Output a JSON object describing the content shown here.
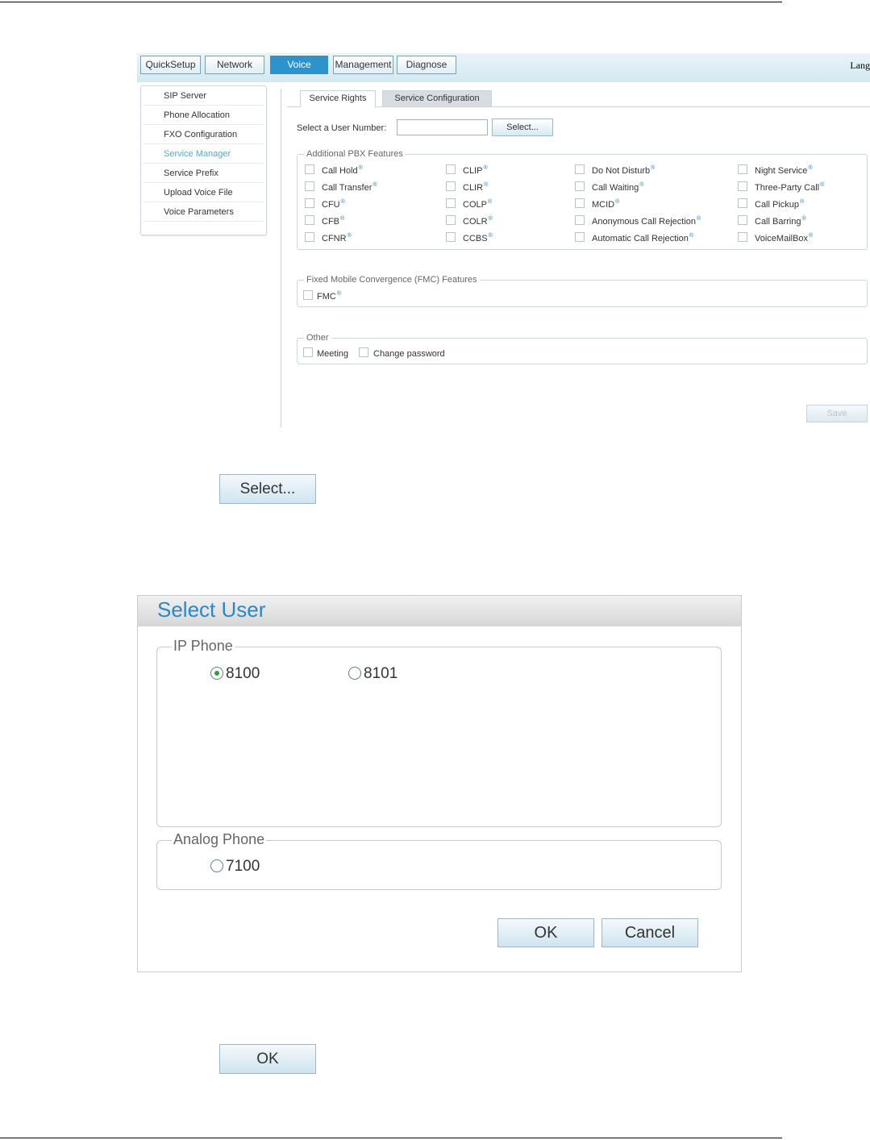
{
  "screenshot": {
    "nav_tabs": [
      "QuickSetup",
      "Network",
      "Voice",
      "Management",
      "Diagnose"
    ],
    "active_nav": "Voice",
    "language_label": "Lang",
    "sidebar": [
      {
        "label": "SIP Server",
        "active": false
      },
      {
        "label": "Phone Allocation",
        "active": false
      },
      {
        "label": "FXO Configuration",
        "active": false
      },
      {
        "label": "Service Manager",
        "active": true
      },
      {
        "label": "Service Prefix",
        "active": false
      },
      {
        "label": "Upload Voice File",
        "active": false
      },
      {
        "label": "Voice Parameters",
        "active": false
      }
    ],
    "sub_tabs": [
      "Service Rights",
      "Service Configuration"
    ],
    "user_number_label": "Select a User Number:",
    "user_number_value": "",
    "select_button": "Select...",
    "pbx": {
      "legend": "Additional PBX Features",
      "columns": [
        [
          "Call Hold",
          "Call Transfer",
          "CFU",
          "CFB",
          "CFNR"
        ],
        [
          "CLIP",
          "CLIR",
          "COLP",
          "COLR",
          "CCBS"
        ],
        [
          "Do Not Disturb",
          "Call Waiting",
          "MCID",
          "Anonymous Call Rejection",
          "Automatic Call Rejection"
        ],
        [
          "Night Service",
          "Three-Party Call",
          "Call Pickup",
          "Call Barring",
          "VoiceMailBox"
        ]
      ]
    },
    "fmc": {
      "legend": "Fixed Mobile Convergence (FMC) Features",
      "items": [
        "FMC"
      ]
    },
    "other": {
      "legend": "Other",
      "items": [
        "Meeting",
        "Change password"
      ]
    },
    "save_button": "Save"
  },
  "select_button_large": "Select...",
  "dialog": {
    "title": "Select User",
    "ip_phone": {
      "legend": "IP Phone",
      "options": [
        {
          "label": "8100",
          "checked": true
        },
        {
          "label": "8101",
          "checked": false
        }
      ]
    },
    "analog_phone": {
      "legend": "Analog Phone",
      "options": [
        {
          "label": "7100",
          "checked": false
        }
      ]
    },
    "ok_button": "OK",
    "cancel_button": "Cancel"
  },
  "ok_button_large": "OK"
}
